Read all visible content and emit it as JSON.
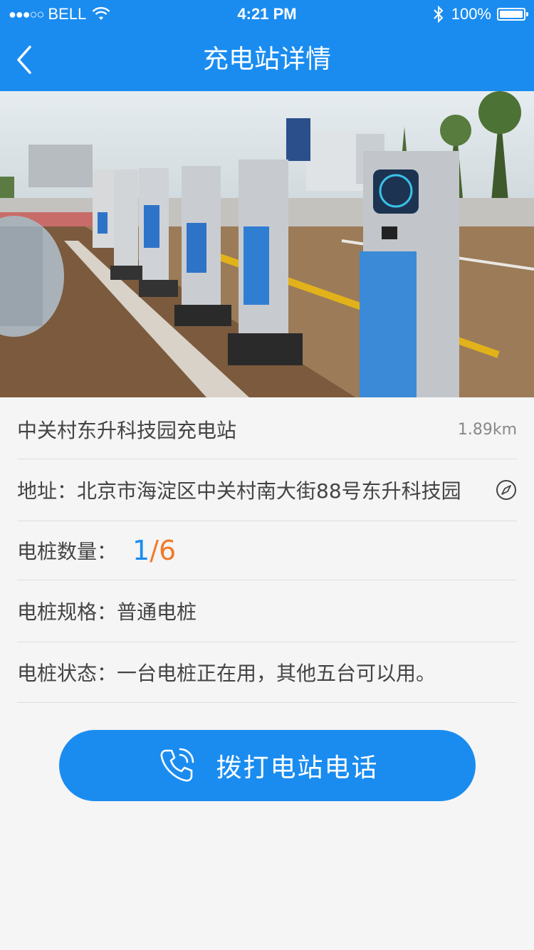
{
  "status": {
    "carrier": "BELL",
    "time": "4:21 PM",
    "battery": "100%"
  },
  "nav": {
    "title": "充电站详情"
  },
  "station": {
    "name": "中关村东升科技园充电站",
    "distance": "1.89km",
    "address_label": "地址：",
    "address": "北京市海淀区中关村南大街88号东升科技园",
    "count_label": "电桩数量：",
    "count_in_use": "1",
    "count_sep": "/",
    "count_total": "6",
    "spec_label": "电桩规格：",
    "spec": "普通电桩",
    "state_label": "电桩状态：",
    "state": "一台电桩正在用，其他五台可以用。"
  },
  "call_button": {
    "label": "拨打电站电话"
  },
  "colors": {
    "primary": "#1a8cf0",
    "accent": "#f07a2a"
  },
  "icons": [
    "back-chevron-icon",
    "wifi-icon",
    "bluetooth-icon",
    "battery-icon",
    "compass-icon",
    "phone-icon"
  ]
}
